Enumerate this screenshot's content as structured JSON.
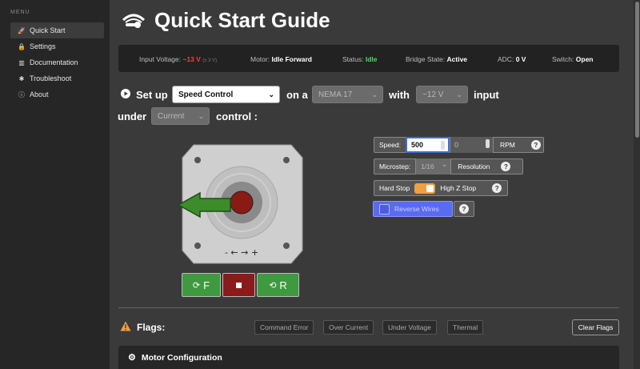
{
  "sidebar": {
    "menu_title": "MENU",
    "items": [
      {
        "label": "Quick Start",
        "icon": "rocket-icon",
        "active": true
      },
      {
        "label": "Settings",
        "icon": "lock-icon"
      },
      {
        "label": "Documentation",
        "icon": "book-icon"
      },
      {
        "label": "Troubleshoot",
        "icon": "bug-icon"
      },
      {
        "label": "About",
        "icon": "info-icon"
      }
    ]
  },
  "header": {
    "title": "Quick Start Guide"
  },
  "status": {
    "input_voltage_label": "Input Voltage:",
    "input_voltage_value": "~13 V",
    "input_voltage_extra": "(± 3 V)",
    "motor_label": "Motor:",
    "motor_value": "Idle Forward",
    "status_label": "Status:",
    "status_value": "Idle",
    "bridge_label": "Bridge State:",
    "bridge_value": "Active",
    "adc_label": "ADC:",
    "adc_value": "0 V",
    "switch_label": "Switch:",
    "switch_value": "Open"
  },
  "setup": {
    "prefix": "Set up",
    "mode_select": "Speed Control",
    "on_a": "on a",
    "motor_select": "NEMA 17",
    "with": "with",
    "voltage_select": "~12 V",
    "input": "input",
    "under": "under",
    "control_select": "Current",
    "control_suffix": "control :"
  },
  "motor": {
    "direction_label": "- ← → +"
  },
  "controls": {
    "forward_label": "F",
    "reverse_label": "R",
    "speed_label": "Speed:",
    "speed_value": "500",
    "speed_second_value": "0",
    "speed_unit": "RPM",
    "microstep_label": "Microstep:",
    "microstep_value": "1/16",
    "resolution_label": "Resolution",
    "hard_stop_label": "Hard Stop",
    "high_z_label": "High Z Stop",
    "hard_stop_enabled": true,
    "reverse_wires_label": "Reverse Wires",
    "help_glyph": "?"
  },
  "flags": {
    "title": "Flags:",
    "items": [
      "Command Error",
      "Over Current",
      "Under Voltage",
      "Thermal"
    ],
    "clear_label": "Clear Flags"
  },
  "motor_config": {
    "title": "Motor Configuration"
  },
  "colors": {
    "accent_blue": "#5a6bf0",
    "green_button": "#3f9a3f",
    "stop_red": "#8b1a1a",
    "toggle_orange": "#f0a040",
    "status_red": "#ff3b30",
    "status_green": "#4cd964"
  }
}
